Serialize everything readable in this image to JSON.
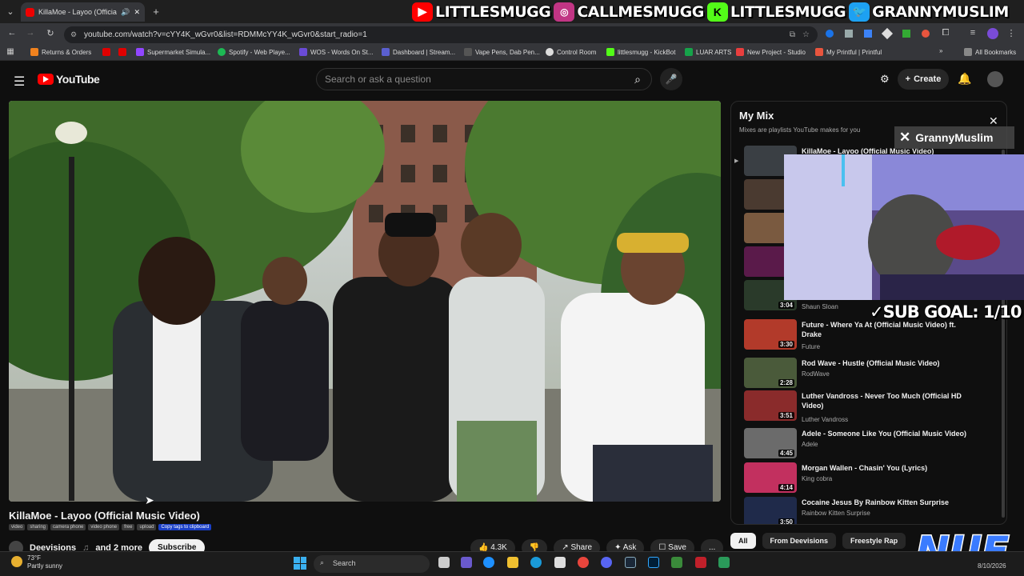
{
  "browser": {
    "tab_title": "KillaMoe - Layoo (Official M",
    "url": "youtube.com/watch?v=cYY4K_wGvr0&list=RDMMcYY4K_wGvr0&start_radio=1",
    "new_tab": "+",
    "bookmarks": [
      {
        "label": "Returns & Orders",
        "color": "#f0821e"
      },
      {
        "label": "",
        "color": "#e00000"
      },
      {
        "label": "",
        "color": "#e00000"
      },
      {
        "label": "Supermarket Simula...",
        "color": "#9146ff"
      },
      {
        "label": "Spotify - Web Playe...",
        "color": "#1db954"
      },
      {
        "label": "WOS - Words On St...",
        "color": "#6a4bd6"
      },
      {
        "label": "Dashboard | Stream...",
        "color": "#5a5fcf"
      },
      {
        "label": "Vape Pens, Dab Pen...",
        "color": "#555555"
      },
      {
        "label": "Control Room",
        "color": "#dddddd"
      },
      {
        "label": "littlesmugg - KickBot",
        "color": "#53fc18"
      },
      {
        "label": "LUAR ARTS",
        "color": "#16a34a"
      },
      {
        "label": "New Project - Studio",
        "color": "#e83e3e"
      },
      {
        "label": "My Printful | Printful",
        "color": "#e8553e"
      }
    ],
    "all_bookmarks": "All Bookmarks"
  },
  "overlay": {
    "socials": [
      {
        "icon": "youtube-icon",
        "text": "LITTLESMUGG",
        "color": "#ff0000"
      },
      {
        "icon": "instagram-icon",
        "text": "CALLMESMUGG",
        "color": "#c13584"
      },
      {
        "icon": "kick-icon",
        "text": "LITTLESMUGG",
        "color": "#53fc18"
      },
      {
        "icon": "twitter-icon",
        "text": "GRANNYMUSLIM",
        "color": "#1da1f2"
      }
    ],
    "x_handle": "GrannyMuslim",
    "sub_goal": "SUB GOAL: 1/10",
    "brand": "NUE"
  },
  "youtube": {
    "logo_text": "YouTube",
    "search_placeholder": "Search or ask a question",
    "create_label": "Create",
    "video_title": "KillaMoe - Layoo (Official Music Video)",
    "tags": [
      "video",
      "sharing",
      "camera phone",
      "video phone",
      "free",
      "upload"
    ],
    "copy_tags": "Copy tags to clipboard",
    "channel": "Deevisions",
    "and_more": "and 2 more",
    "subscribe": "Subscribe",
    "likes": "4.3K",
    "share": "Share",
    "ask": "Ask",
    "save": "Save",
    "more": "..."
  },
  "mix": {
    "title": "My Mix",
    "subtitle": "Mixes are playlists YouTube makes for you",
    "first_item": "KillaMoe - Layoo (Official Music Video)",
    "hidden_channel": "Shaun Sloan",
    "hidden_duration": "3:04",
    "items": [
      {
        "title": "Future - Where Ya At (Official Music Video) ft. Drake",
        "channel": "Future",
        "duration": "3:30",
        "color": "#b23a2a"
      },
      {
        "title": "Rod Wave - Hustle (Official Music Video)",
        "channel": "RodWave",
        "duration": "2:28",
        "color": "#4a5a3a"
      },
      {
        "title": "Luther Vandross - Never Too Much (Official HD Video)",
        "channel": "Luther Vandross",
        "duration": "3:51",
        "color": "#8a2b2b"
      },
      {
        "title": "Adele - Someone Like You (Official Music Video)",
        "channel": "Adele",
        "duration": "4:45",
        "color": "#6b6b6b"
      },
      {
        "title": "Morgan Wallen - Chasin' You (Lyrics)",
        "channel": "King cobra",
        "duration": "4:14",
        "color": "#c2305f"
      },
      {
        "title": "Cocaine Jesus By Rainbow Kitten Surprise",
        "channel": "Rainbow Kitten Surprise",
        "duration": "3:50",
        "color": "#1f2a4a"
      }
    ],
    "chips": [
      "All",
      "From Deevisions",
      "Freestyle Rap"
    ]
  },
  "taskbar": {
    "temp": "73°F",
    "condition": "Partly sunny",
    "search": "Search",
    "date": "8/10/2026"
  }
}
